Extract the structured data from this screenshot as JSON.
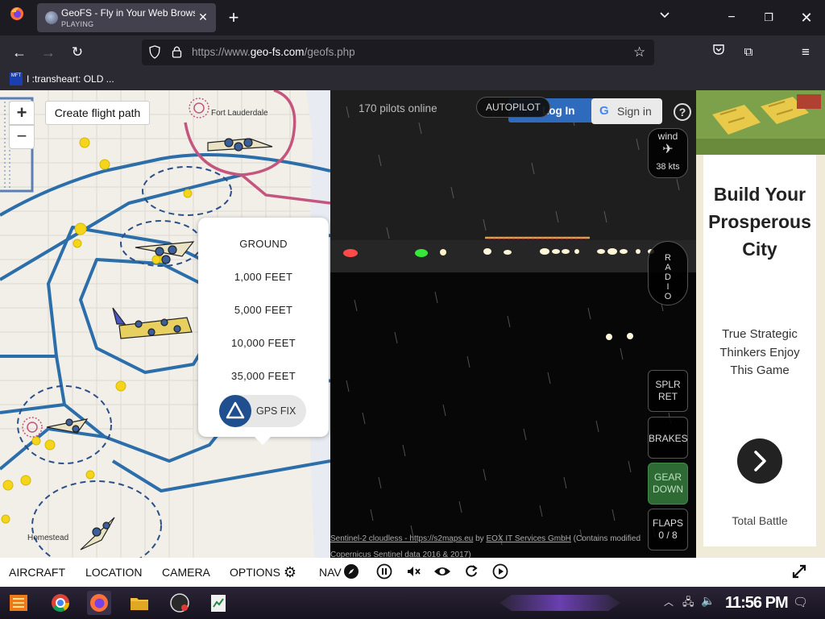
{
  "browser": {
    "tab_title": "GeoFS - Fly in Your Web Browser",
    "tab_status": "PLAYING",
    "url_prefix": "https://www.",
    "url_domain": "geo-fs.com",
    "url_path": "/geofs.php",
    "bookmark_label": "I :transheart: OLD ...",
    "bookmark_icon_text": "MFT"
  },
  "map": {
    "zoom_in": "+",
    "zoom_out": "−",
    "create_flight_path": "Create flight path",
    "labels": {
      "fort_lauderdale": "Fort Lauderdale",
      "homestead": "Homestead"
    },
    "altitude_options": [
      "GROUND",
      "1,000 FEET",
      "5,000 FEET",
      "10,000 FEET",
      "35,000 FEET"
    ],
    "gps_fix_label": "GPS FIX"
  },
  "hud": {
    "pilots_online": "170 pilots online",
    "autopilot": "AUTOPILOT",
    "log_in": "Log In",
    "sign_in": "Sign in",
    "help": "?",
    "wind_label": "wind",
    "wind_speed": "38 kts",
    "radio": "RADIO",
    "spoilers_line1": "SPLR",
    "spoilers_line2": "RET",
    "brakes": "BRAKES",
    "gear_line1": "GEAR",
    "gear_line2": "DOWN",
    "flaps_line1": "FLAPS",
    "flaps_line2": "0 / 8",
    "attribution_link1": "Sentinel-2 cloudless - https://s2maps.eu",
    "attribution_by": " by ",
    "attribution_link2": "EOX IT Services GmbH",
    "attribution_tail": " (Contains modified Copernicus Sentinel data 2016 & 2017)"
  },
  "ad": {
    "headline": "Build Your Prosperous City",
    "subtext": "True Strategic Thinkers Enjoy This Game",
    "cta_icon": "chevron-right-icon",
    "brand": "Total Battle"
  },
  "toolbar": {
    "aircraft": "AIRCRAFT",
    "location": "LOCATION",
    "camera": "CAMERA",
    "options": "OPTIONS",
    "nav": "NAV"
  },
  "taskbar": {
    "time": "11:56 PM"
  },
  "colors": {
    "gear_green": "#2e6b34",
    "login_blue": "#2f6bbd",
    "airspace_blue": "#2c6eaa",
    "airspace_magenta": "#c4557e"
  }
}
